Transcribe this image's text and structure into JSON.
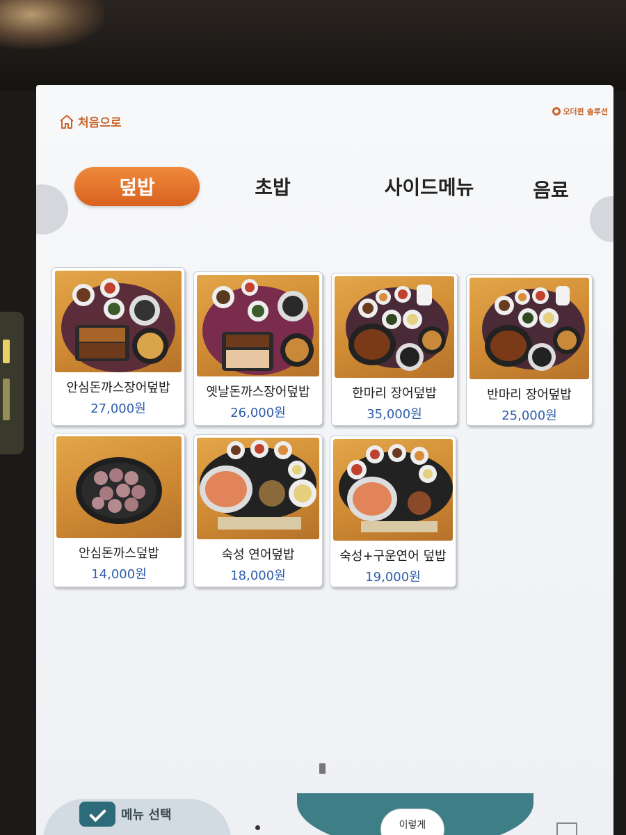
{
  "header": {
    "home_label": "처음으로",
    "brand_label": "오더퀸 솔루션"
  },
  "tabs": [
    {
      "label": "덮밥",
      "active": true
    },
    {
      "label": "초밥",
      "active": false
    },
    {
      "label": "사이드메뉴",
      "active": false
    },
    {
      "label": "음료",
      "active": false
    }
  ],
  "menu_items": [
    {
      "name": "안심돈까스장어덮밥",
      "price": "27,000원",
      "photo_icon": "cutlet-eel-set-photo"
    },
    {
      "name": "옛날돈까스장어덮밥",
      "price": "26,000원",
      "photo_icon": "old-style-cutlet-eel-set-photo"
    },
    {
      "name": "한마리 장어덮밥",
      "price": "35,000원",
      "photo_icon": "whole-eel-bowl-photo"
    },
    {
      "name": "반마리 장어덮밥",
      "price": "25,000원",
      "photo_icon": "half-eel-bowl-photo"
    },
    {
      "name": "안심돈까스덮밥",
      "price": "14,000원",
      "photo_icon": "tenderloin-cutlet-bowl-photo"
    },
    {
      "name": "숙성 연어덮밥",
      "price": "18,000원",
      "photo_icon": "aged-salmon-bowl-photo"
    },
    {
      "name": "숙성+구운연어 덮밥",
      "price": "19,000원",
      "photo_icon": "aged-grilled-salmon-bowl-photo"
    }
  ],
  "footer": {
    "step_label": "메뉴 선택",
    "how_label": "이렇게"
  },
  "colors": {
    "accent": "#d8611e",
    "price": "#2f5dab",
    "step_teal": "#3e7e86"
  }
}
